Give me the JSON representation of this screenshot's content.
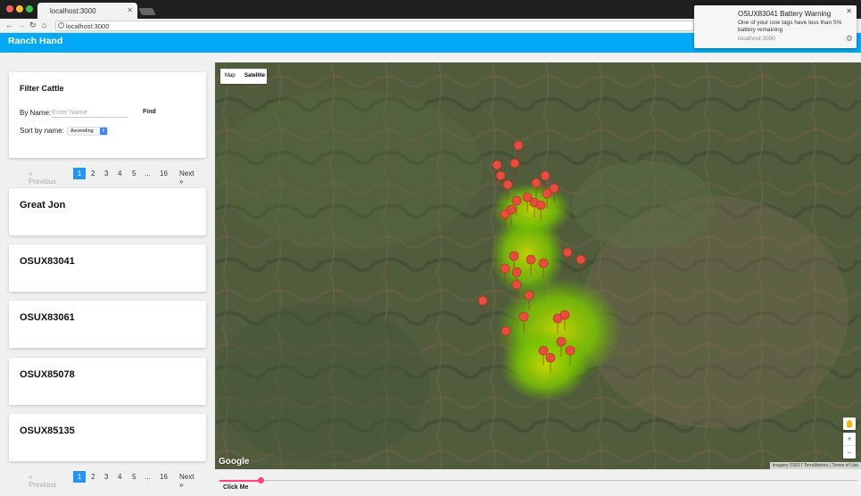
{
  "browser": {
    "tab_title": "localhost:3000",
    "tab_close": "✕",
    "url": "localhost:3000",
    "nav": {
      "back": "←",
      "forward": "→",
      "reload": "↻",
      "home": "⌂"
    }
  },
  "notification": {
    "title": "OSUX83041 Battery Warning",
    "body": "One of your cow tags have less than 5% battery remaining",
    "source": "localhost:3000",
    "close": "✕",
    "gear": "⚙"
  },
  "app": {
    "title": "Ranch Hand",
    "accent_color": "#03a9f4",
    "slider_color": "#ff4081"
  },
  "filter": {
    "title": "Filter Cattle",
    "by_name_label": "By Name:",
    "name_placeholder": "Enter Name",
    "find_label": "Find",
    "sort_label": "Sort by name:",
    "sort_value": "Ascending"
  },
  "pagination": {
    "previous": "« Previous",
    "pages": [
      "1",
      "2",
      "3",
      "4",
      "5",
      "...",
      "16"
    ],
    "next": "Next »",
    "active_page": "1"
  },
  "cattle": [
    "Great Jon",
    "OSUX83041",
    "OSUX83061",
    "OSUX85078",
    "OSUX85135"
  ],
  "map": {
    "type_map": "Map",
    "type_satellite": "Satellite",
    "logo": "Google",
    "attribution": "Imagery ©2017 TerraMetrics | Terms of Use",
    "zoom_in": "+",
    "zoom_out": "−"
  },
  "slider": {
    "label": "Click Me"
  }
}
